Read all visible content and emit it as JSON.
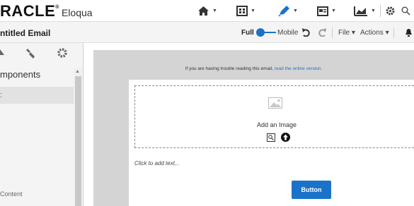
{
  "app": {
    "brand_main": "RACLE",
    "brand_mark": "®",
    "brand_sub": "Eloqua"
  },
  "topnav": {
    "icons": [
      "home-icon",
      "campaigns-icon",
      "assets-icon",
      "contacts-icon",
      "insight-icon",
      "settings-icon",
      "search-icon"
    ]
  },
  "toolbar": {
    "title": "ntitled Email",
    "full_label": "Full",
    "mobile_label": "Mobile",
    "file_label": "File ▾",
    "actions_label": "Actions ▾"
  },
  "leftpanel": {
    "tabs": [
      "layout-icon",
      "style-icon",
      "settings-icon"
    ],
    "section_title": "mponents",
    "selected_item": ":",
    "footer_label": "Content"
  },
  "canvas": {
    "trouble_text": "If you are having trouble reading this email, ",
    "trouble_link": "read the online version.",
    "add_image": "Add an Image",
    "click_text": "Click to add text...",
    "button_label": "Button"
  },
  "colors": {
    "accent": "#1a73c9",
    "canvas_bg": "#d4d4d4",
    "panel_bg": "#f4f4f4"
  }
}
